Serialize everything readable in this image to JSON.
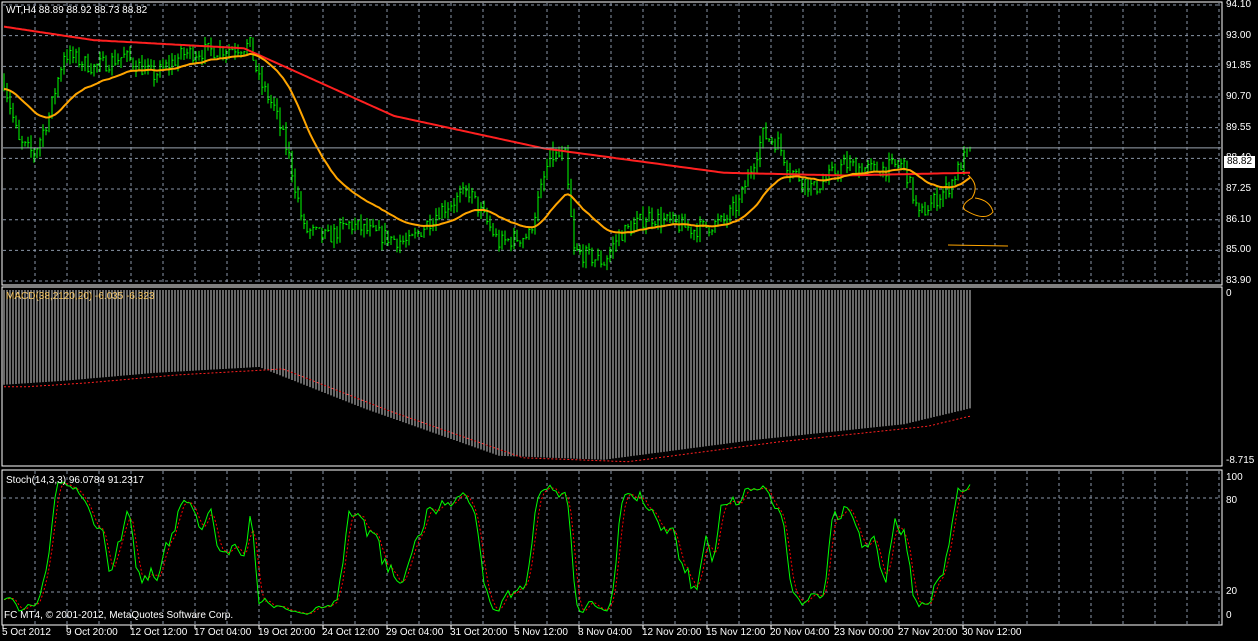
{
  "header": {
    "symbol_line": "WT,H4  88.89 88.92 88.73 88.82"
  },
  "price_axis": [
    "94.10",
    "93.00",
    "91.85",
    "90.70",
    "89.55",
    "88.40",
    "87.25",
    "86.10",
    "85.00",
    "83.90"
  ],
  "current_price": "88.82",
  "macd": {
    "label": "MACD(38,2120,20) -6.035 -6.323",
    "axis_top": "0",
    "axis_bottom": "-8.715"
  },
  "stoch": {
    "label": "Stoch(14,3,3) 96.0784 91.2317",
    "axis": [
      "100",
      "80",
      "20",
      "0"
    ]
  },
  "copyright": "FC MT4, © 2001-2012, MetaQuotes Software Corp.",
  "time_axis": [
    "5 Oct 2012",
    "9 Oct 20:00",
    "12 Oct 12:00",
    "17 Oct 04:00",
    "19 Oct 20:00",
    "24 Oct 12:00",
    "29 Oct 04:00",
    "31 Oct 20:00",
    "5 Nov 12:00",
    "8 Nov 04:00",
    "12 Nov 20:00",
    "15 Nov 12:00",
    "20 Nov 04:00",
    "23 Nov 00:00",
    "27 Nov 20:00",
    "30 Nov 12:00"
  ],
  "colors": {
    "bars": "#00ff00",
    "ma_slow": "#ff2020",
    "ma_fast": "#ffa500",
    "grid": "#8a96a8",
    "stoch_signal": "#ff0000"
  },
  "chart_data": {
    "type": "line",
    "bar_count": 323,
    "price_range": [
      83.9,
      94.1
    ],
    "close_anchors": [
      [
        0,
        91.3
      ],
      [
        5,
        89.0
      ],
      [
        10,
        88.6
      ],
      [
        15,
        90.0
      ],
      [
        20,
        92.3
      ],
      [
        30,
        91.8
      ],
      [
        40,
        92.2
      ],
      [
        50,
        91.5
      ],
      [
        60,
        92.3
      ],
      [
        75,
        92.5
      ],
      [
        82,
        92.6
      ],
      [
        85,
        91.3
      ],
      [
        90,
        90.3
      ],
      [
        95,
        88.5
      ],
      [
        100,
        85.8
      ],
      [
        108,
        85.5
      ],
      [
        115,
        86.0
      ],
      [
        125,
        85.6
      ],
      [
        135,
        85.3
      ],
      [
        145,
        86.5
      ],
      [
        155,
        87.2
      ],
      [
        165,
        85.3
      ],
      [
        175,
        85.6
      ],
      [
        182,
        88.5
      ],
      [
        187,
        88.5
      ],
      [
        190,
        85.0
      ],
      [
        200,
        84.6
      ],
      [
        205,
        85.6
      ],
      [
        215,
        86.3
      ],
      [
        230,
        85.8
      ],
      [
        240,
        86.1
      ],
      [
        245,
        86.8
      ],
      [
        253,
        89.3
      ],
      [
        258,
        89.0
      ],
      [
        262,
        88.0
      ],
      [
        270,
        87.3
      ],
      [
        280,
        88.2
      ],
      [
        290,
        88.0
      ],
      [
        300,
        88.2
      ],
      [
        305,
        86.3
      ],
      [
        315,
        87.4
      ],
      [
        322,
        88.82
      ]
    ],
    "ma_slow_anchors": [
      [
        0,
        93.3
      ],
      [
        30,
        92.8
      ],
      [
        80,
        92.5
      ],
      [
        90,
        92.0
      ],
      [
        130,
        90.0
      ],
      [
        180,
        88.8
      ],
      [
        240,
        87.9
      ],
      [
        280,
        87.8
      ],
      [
        322,
        87.9
      ]
    ],
    "macd_range": [
      -8.715,
      0
    ],
    "macd_anchors": [
      [
        0,
        -4.8
      ],
      [
        20,
        -4.6
      ],
      [
        50,
        -4.2
      ],
      [
        85,
        -3.9
      ],
      [
        120,
        -6.0
      ],
      [
        165,
        -8.4
      ],
      [
        200,
        -8.6
      ],
      [
        250,
        -7.6
      ],
      [
        300,
        -6.8
      ],
      [
        322,
        -6.0
      ]
    ],
    "stoch_range": [
      0,
      100
    ]
  }
}
